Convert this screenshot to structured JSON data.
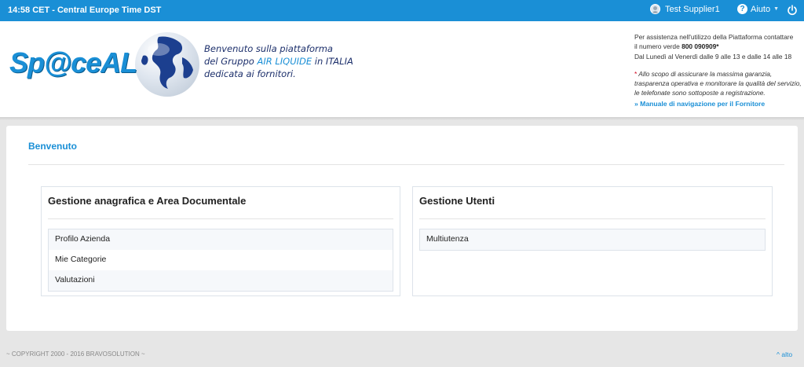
{
  "topbar": {
    "clock": "14:58 CET - Central Europe Time DST",
    "user_name": "Test Supplier1",
    "help_label": "Aiuto"
  },
  "header": {
    "logo_text_pre": "Sp",
    "logo_text_at": "@",
    "logo_text_post": "ceAL",
    "tagline_line1": "Benvenuto sulla piattaforma",
    "tagline_line2_pre": "del Gruppo ",
    "tagline_line2_hl": "AIR LIQUIDE",
    "tagline_line2_post": " in ITALIA",
    "tagline_line3": "dedicata ai fornitori.",
    "assist_line1": "Per assistenza nell'utilizzo della Piattaforma contattare",
    "assist_line2_pre": "il numero verde ",
    "assist_phone": "800 090909*",
    "assist_line3": "Dal Lunedì al Venerdì dalle 9 alle 13 e dalle 14 alle 18",
    "note_star": "*",
    "note_line1": " Allo scopo di assicurare la massima garanzia,",
    "note_line2": "trasparenza operativa e monitorare la qualità del servizio,",
    "note_line3": "le telefonate sono sottoposte a registrazione.",
    "manual_link": "» Manuale di navigazione per il Fornitore"
  },
  "main": {
    "welcome": "Benvenuto",
    "panels": [
      {
        "title": "Gestione anagrafica e Area Documentale",
        "items": [
          "Profilo Azienda",
          "Mie Categorie",
          "Valutazioni"
        ]
      },
      {
        "title": "Gestione Utenti",
        "items": [
          "Multiutenza"
        ]
      }
    ]
  },
  "footer": {
    "copyright": "~ COPYRIGHT 2000 - 2016 BRAVOSOLUTION ~",
    "top_link": "^ alto"
  },
  "colors": {
    "accent": "#1a8fd6",
    "background": "#e6e6e6"
  }
}
